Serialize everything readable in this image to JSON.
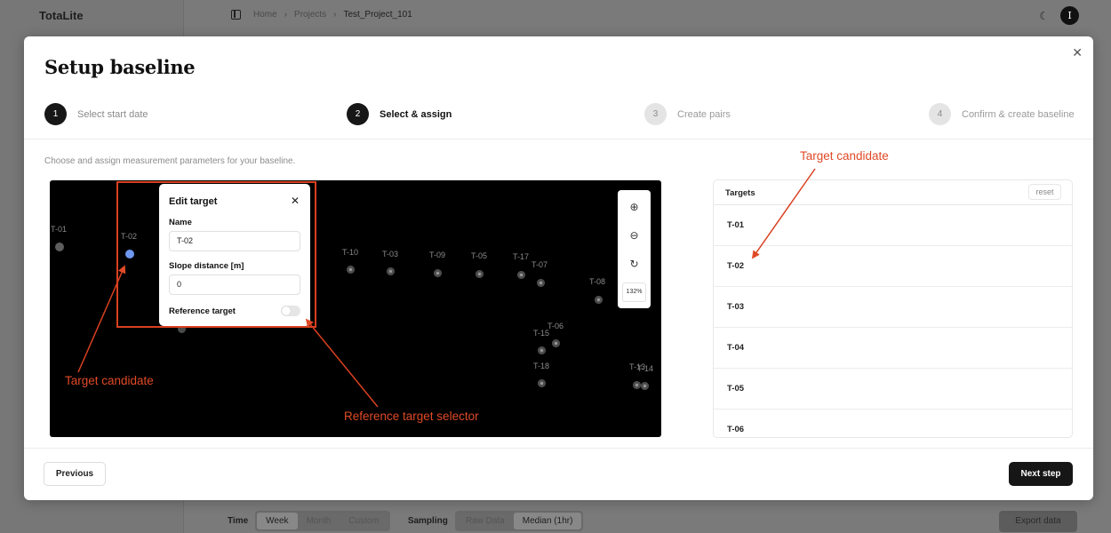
{
  "app": {
    "brand": "TotaLite",
    "breadcrumb": [
      "Home",
      "Projects",
      "Test_Project_101"
    ],
    "user_initial": "I",
    "theme_icon": "moon-icon"
  },
  "bottom_bar": {
    "time_label": "Time",
    "time_options": [
      "Week",
      "Month",
      "Custom"
    ],
    "sampling_label": "Sampling",
    "sampling_options": [
      "Raw Data",
      "Median (1hr)"
    ],
    "export_label": "Export data"
  },
  "modal": {
    "title": "Setup baseline",
    "close_icon": "close-icon",
    "steps": [
      {
        "num": "1",
        "label": "Select start date",
        "state": "done"
      },
      {
        "num": "2",
        "label": "Select & assign",
        "state": "active"
      },
      {
        "num": "3",
        "label": "Create pairs",
        "state": "upcoming"
      },
      {
        "num": "4",
        "label": "Confirm & create baseline",
        "state": "upcoming"
      }
    ],
    "subtitle": "Choose and assign measurement parameters for your baseline.",
    "canvas": {
      "labels": [
        "T-01",
        "T-02",
        "T-10",
        "T-03",
        "T-09",
        "T-05",
        "T-17",
        "T-07",
        "T-08",
        "T-15",
        "T-06",
        "T-18",
        "T-13",
        "T-14"
      ],
      "selected": "T-02"
    },
    "zoom": {
      "zoom_in_icon": "zoom-in-icon",
      "zoom_out_icon": "zoom-out-icon",
      "reset_icon": "rotate-icon",
      "percent": "132%"
    },
    "edit_target": {
      "title": "Edit target",
      "name_label": "Name",
      "name_value": "T-02",
      "slope_label": "Slope distance [m]",
      "slope_value": "0",
      "reference_label": "Reference target",
      "reference_on": false
    },
    "annotations": {
      "target_candidate_left": "Target candidate",
      "target_candidate_right": "Target candidate",
      "reference_selector": "Reference target selector"
    },
    "targets_panel": {
      "title": "Targets",
      "reset_label": "reset",
      "rows": [
        "T-01",
        "T-02",
        "T-03",
        "T-04",
        "T-05",
        "T-06"
      ]
    },
    "previous_label": "Previous",
    "next_label": "Next step"
  }
}
